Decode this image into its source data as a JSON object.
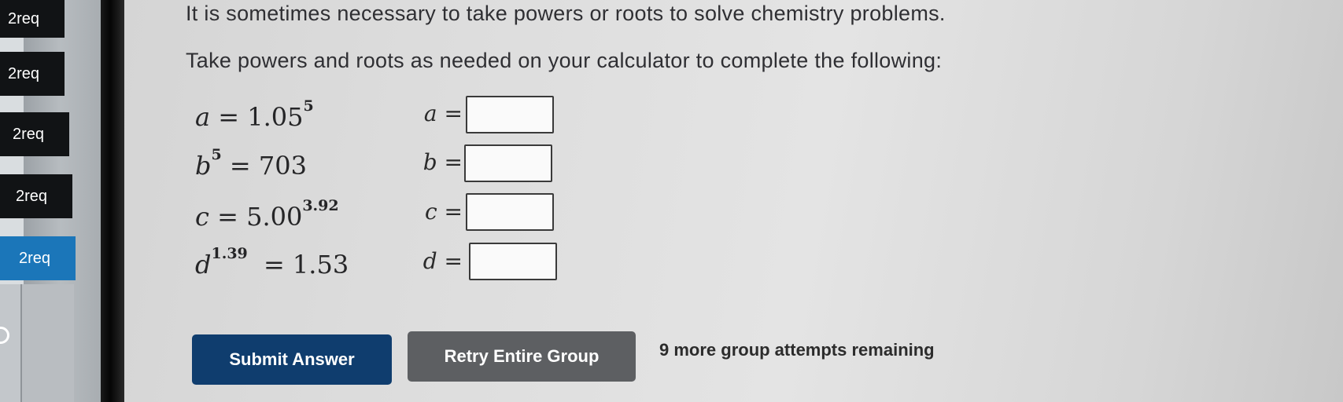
{
  "sidebar": {
    "tabs": [
      {
        "label": "2req"
      },
      {
        "label": "2req"
      },
      {
        "label": "2req"
      },
      {
        "label": "2req"
      },
      {
        "label": "2req"
      }
    ]
  },
  "problem": {
    "intro_line_1": "It is sometimes necessary to take powers or roots to solve chemistry problems.",
    "intro_line_2": "Take powers and roots as needed on your calculator to complete the following:",
    "equations": [
      {
        "lhs_base": "a",
        "lhs_exp": "",
        "rhs_base": "1.05",
        "rhs_exp": "5",
        "answer_var": "a",
        "answer_value": ""
      },
      {
        "lhs_base": "b",
        "lhs_exp": "5",
        "rhs_base": "703",
        "rhs_exp": "",
        "answer_var": "b",
        "answer_value": ""
      },
      {
        "lhs_base": "c",
        "lhs_exp": "",
        "rhs_base": "5.00",
        "rhs_exp": "3.92",
        "answer_var": "c",
        "answer_value": ""
      },
      {
        "lhs_base": "d",
        "lhs_exp": "1.39",
        "rhs_base": "1.53",
        "rhs_exp": "",
        "answer_var": "d",
        "answer_value": ""
      }
    ],
    "equals_sign": "=",
    "answer_equals": "="
  },
  "actions": {
    "submit_label": "Submit Answer",
    "retry_label": "Retry Entire Group",
    "attempts_text": "9 more group attempts remaining"
  },
  "colors": {
    "submit_bg": "#0f3d6e",
    "retry_bg": "#5d5f62",
    "active_tab": "#1b76b9",
    "dark_tab": "#111315"
  }
}
